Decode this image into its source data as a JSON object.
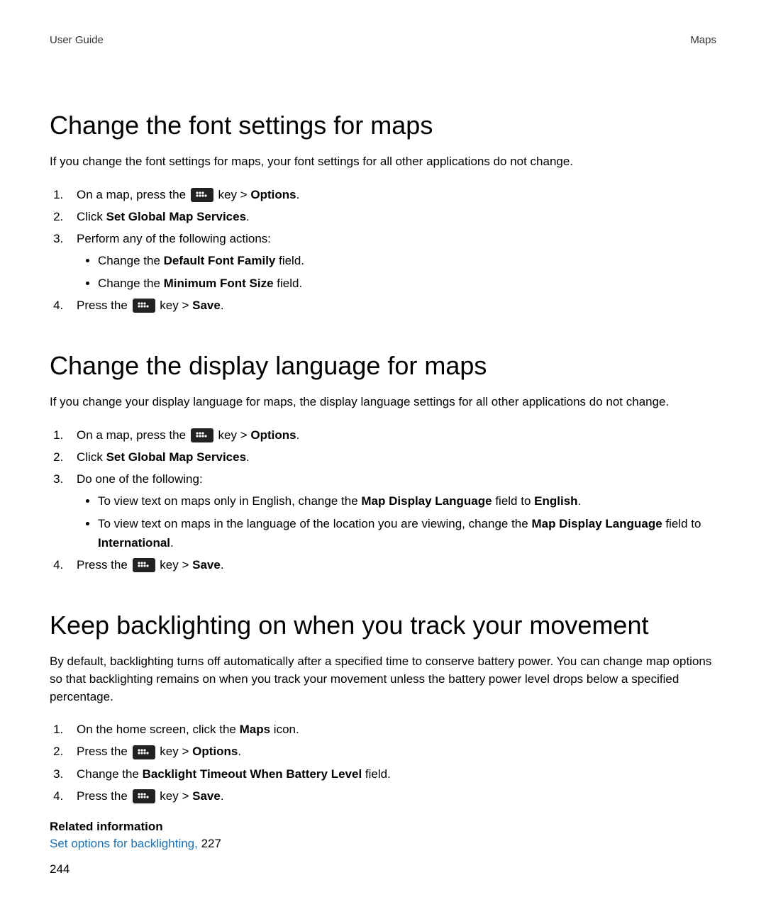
{
  "header": {
    "left": "User Guide",
    "right": "Maps"
  },
  "section1": {
    "heading": "Change the font settings for maps",
    "intro": "If you change the font settings for maps, your font settings for all other applications do not change.",
    "step1_a": "On a map, press the",
    "step1_b": "key >",
    "step1_c": "Options",
    "step1_d": ".",
    "step2_a": "Click ",
    "step2_b": "Set Global Map Services",
    "step2_c": ".",
    "step3": "Perform any of the following actions:",
    "bullet1_a": "Change the ",
    "bullet1_b": "Default Font Family",
    "bullet1_c": " field.",
    "bullet2_a": "Change the ",
    "bullet2_b": "Minimum Font Size",
    "bullet2_c": " field.",
    "step4_a": "Press the",
    "step4_b": "key >",
    "step4_c": "Save",
    "step4_d": "."
  },
  "section2": {
    "heading": "Change the display language for maps",
    "intro": "If you change your display language for maps, the display language settings for all other applications do not change.",
    "step1_a": "On a map, press the",
    "step1_b": "key >",
    "step1_c": "Options",
    "step1_d": ".",
    "step2_a": "Click ",
    "step2_b": "Set Global Map Services",
    "step2_c": ".",
    "step3": "Do one of the following:",
    "bullet1_a": "To view text on maps only in English, change the ",
    "bullet1_b": "Map Display Language",
    "bullet1_c": " field to ",
    "bullet1_d": "English",
    "bullet1_e": ".",
    "bullet2_a": "To view text on maps in the language of the location you are viewing, change the ",
    "bullet2_b": "Map Display Language",
    "bullet2_c": " field to ",
    "bullet2_d": "International",
    "bullet2_e": ".",
    "step4_a": "Press the",
    "step4_b": "key >",
    "step4_c": "Save",
    "step4_d": "."
  },
  "section3": {
    "heading": "Keep backlighting on when you track your movement",
    "intro": "By default, backlighting turns off automatically after a specified time to conserve battery power. You can change map options so that backlighting remains on when you track your movement unless the battery power level drops below a specified percentage.",
    "step1_a": "On the home screen, click the ",
    "step1_b": "Maps",
    "step1_c": " icon.",
    "step2_a": "Press the",
    "step2_b": "key >",
    "step2_c": "Options",
    "step2_d": ".",
    "step3_a": "Change the ",
    "step3_b": "Backlight Timeout When Battery Level",
    "step3_c": " field.",
    "step4_a": "Press the",
    "step4_b": "key >",
    "step4_c": "Save",
    "step4_d": "."
  },
  "related": {
    "heading": "Related information",
    "link_text": "Set options for backlighting, ",
    "page_ref": "227"
  },
  "page_number": "244"
}
